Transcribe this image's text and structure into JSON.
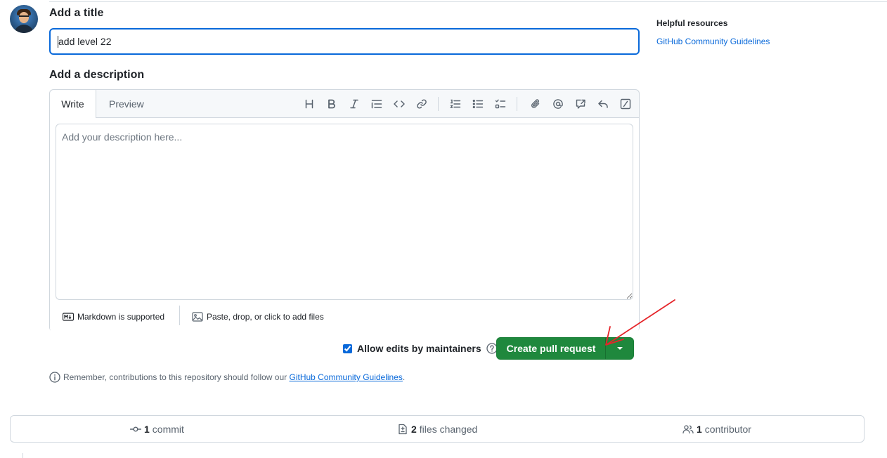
{
  "title_section": {
    "label": "Add a title",
    "value": "add level 22"
  },
  "description_section": {
    "label": "Add a description",
    "tabs": [
      {
        "label": "Write",
        "selected": true
      },
      {
        "label": "Preview",
        "selected": false
      }
    ],
    "toolbar_icons": [
      "heading-icon",
      "bold-icon",
      "italic-icon",
      "quote-icon",
      "code-icon",
      "link-icon",
      "numbered-list-icon",
      "unordered-list-icon",
      "task-list-icon",
      "attach-icon",
      "mention-icon",
      "cross-reference-icon",
      "reply-icon",
      "slash-commands-icon"
    ],
    "placeholder": "Add your description here...",
    "markdown_label": "Markdown is supported",
    "attach_label": "Paste, drop, or click to add files"
  },
  "actions": {
    "allow_edits_label": "Allow edits by maintainers",
    "allow_edits_checked": true,
    "create_label": "Create pull request"
  },
  "note": {
    "text": "Remember, contributions to this repository should follow our",
    "link": "GitHub Community Guidelines",
    "suffix": "."
  },
  "sidebar": {
    "title": "Helpful resources",
    "link": "GitHub Community Guidelines"
  },
  "stats": {
    "commits_count": "1",
    "commits_label": "commit",
    "files_count": "2",
    "files_label": "files changed",
    "contributors_count": "1",
    "contributors_label": "contributor"
  },
  "colors": {
    "accent": "#0969da",
    "primary_button": "#1f883d",
    "annotation_arrow": "#e5252a"
  }
}
